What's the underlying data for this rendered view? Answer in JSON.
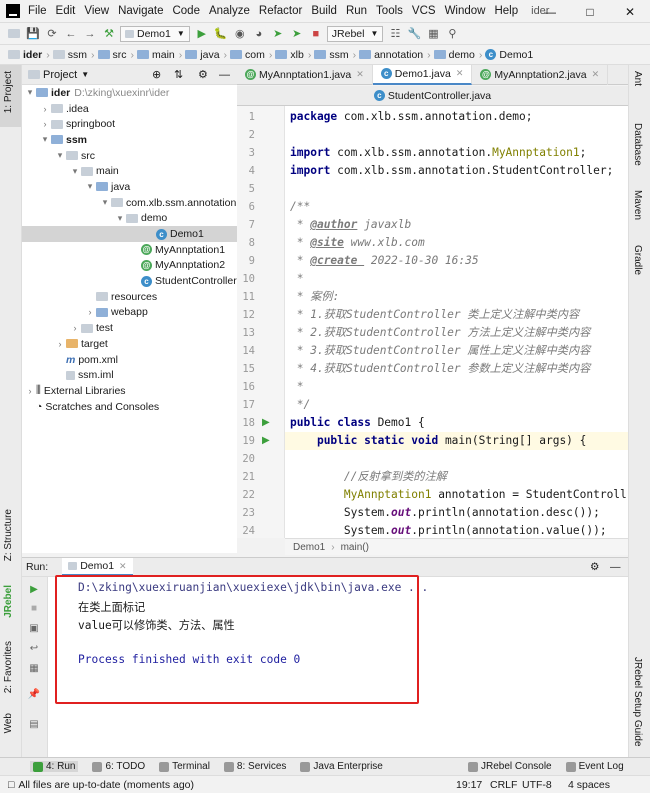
{
  "menu": [
    "File",
    "Edit",
    "View",
    "Navigate",
    "Code",
    "Analyze",
    "Refactor",
    "Build",
    "Run",
    "Tools",
    "VCS",
    "Window",
    "Help"
  ],
  "window_title": "ider",
  "toolbar": {
    "run_config": "Demo1",
    "jrebel": "JRebel"
  },
  "breadcrumb": [
    "ider",
    "ssm",
    "src",
    "main",
    "java",
    "com",
    "xlb",
    "ssm",
    "annotation",
    "demo",
    "Demo1"
  ],
  "left_tools": {
    "project": "1: Project",
    "structure": "Z: Structure",
    "jrebel": "JRebel",
    "favorites": "2: Favorites",
    "web": "Web"
  },
  "right_tools": {
    "ant": "Ant",
    "database": "Database",
    "maven": "Maven",
    "gradle": "Gradle",
    "jrebel_guide": "JRebel Setup Guide"
  },
  "project_panel": {
    "title": "Project"
  },
  "tree": [
    {
      "label": "ider",
      "extra": "D:\\zking\\xuexinr\\ider",
      "depth": 0,
      "arrow": "▾",
      "icon": "folder",
      "bold": true
    },
    {
      "label": ".idea",
      "depth": 1,
      "arrow": "›",
      "icon": "folder-plain"
    },
    {
      "label": "springboot",
      "depth": 1,
      "arrow": "›",
      "icon": "folder-plain"
    },
    {
      "label": "ssm",
      "depth": 1,
      "arrow": "▾",
      "icon": "folder",
      "bold": true
    },
    {
      "label": "src",
      "depth": 2,
      "arrow": "▾",
      "icon": "folder-plain"
    },
    {
      "label": "main",
      "depth": 3,
      "arrow": "▾",
      "icon": "folder-plain"
    },
    {
      "label": "java",
      "depth": 4,
      "arrow": "▾",
      "icon": "folder"
    },
    {
      "label": "com.xlb.ssm.annotation",
      "depth": 5,
      "arrow": "▾",
      "icon": "folder-plain"
    },
    {
      "label": "demo",
      "depth": 6,
      "arrow": "▾",
      "icon": "folder-plain"
    },
    {
      "label": "Demo1",
      "depth": 8,
      "arrow": "",
      "icon": "class",
      "selected": true
    },
    {
      "label": "MyAnnptation1",
      "depth": 7,
      "arrow": "",
      "icon": "annotation"
    },
    {
      "label": "MyAnnptation2",
      "depth": 7,
      "arrow": "",
      "icon": "annotation"
    },
    {
      "label": "StudentController",
      "depth": 7,
      "arrow": "",
      "icon": "class"
    },
    {
      "label": "resources",
      "depth": 4,
      "arrow": "",
      "icon": "folder-plain"
    },
    {
      "label": "webapp",
      "depth": 4,
      "arrow": "›",
      "icon": "folder"
    },
    {
      "label": "test",
      "depth": 3,
      "arrow": "›",
      "icon": "folder-plain"
    },
    {
      "label": "target",
      "depth": 2,
      "arrow": "›",
      "icon": "folder-orange"
    },
    {
      "label": "pom.xml",
      "depth": 2,
      "arrow": "",
      "icon": "maven"
    },
    {
      "label": "ssm.iml",
      "depth": 2,
      "arrow": "",
      "icon": "file"
    },
    {
      "label": "External Libraries",
      "depth": 0,
      "arrow": "›",
      "icon": "library"
    },
    {
      "label": "Scratches and Consoles",
      "depth": 0,
      "arrow": "",
      "icon": "scratch"
    }
  ],
  "editor_tabs": [
    {
      "label": "MyAnnptation1.java",
      "icon": "annotation"
    },
    {
      "label": "Demo1.java",
      "icon": "class",
      "active": true
    },
    {
      "label": "MyAnnptation2.java",
      "icon": "annotation"
    }
  ],
  "editor_tab_row2": "StudentController.java",
  "code_lines": [
    {
      "n": "1",
      "html": "<span class=\"kw\">package</span> com.xlb.ssm.annotation.demo;"
    },
    {
      "n": "2",
      "html": ""
    },
    {
      "n": "3",
      "html": "<span class=\"kw\">import</span> com.xlb.ssm.annotation.<span class=\"ann\">MyAnnptation1</span>;"
    },
    {
      "n": "4",
      "html": "<span class=\"kw\">import</span> com.xlb.ssm.annotation.StudentController;"
    },
    {
      "n": "5",
      "html": ""
    },
    {
      "n": "6",
      "html": "<span class=\"cm\">/**</span>"
    },
    {
      "n": "7",
      "html": "<span class=\"cm\"> * </span><span class=\"tag\">@author</span><span class=\"cm\"> javaxlb</span>"
    },
    {
      "n": "8",
      "html": "<span class=\"cm\"> * </span><span class=\"tag\">@site</span><span class=\"cm\"> www.xlb.com</span>"
    },
    {
      "n": "9",
      "html": "<span class=\"cm\"> * </span><span class=\"tag\">@create </span><span class=\"cm\"> 2022-10-30 16:35</span>"
    },
    {
      "n": "10",
      "html": "<span class=\"cm\"> *</span>"
    },
    {
      "n": "11",
      "html": "<span class=\"cm\"> * 案例:</span>"
    },
    {
      "n": "12",
      "html": "<span class=\"cm\"> * 1.获取StudentController 类上定义注解中类内容</span>"
    },
    {
      "n": "13",
      "html": "<span class=\"cm\"> * 2.获取StudentController 方法上定义注解中类内容</span>"
    },
    {
      "n": "14",
      "html": "<span class=\"cm\"> * 3.获取StudentController 属性上定义注解中类内容</span>"
    },
    {
      "n": "15",
      "html": "<span class=\"cm\"> * 4.获取StudentController 参数上定义注解中类内容</span>"
    },
    {
      "n": "16",
      "html": "<span class=\"cm\"> *</span>"
    },
    {
      "n": "17",
      "html": "<span class=\"cm\"> */</span>"
    },
    {
      "n": "18",
      "html": "<span class=\"kw\">public class</span> Demo1 {"
    },
    {
      "n": "19",
      "html": "    <span class=\"kw\">public static void</span> main(String[] args) {"
    },
    {
      "n": "20",
      "html": ""
    },
    {
      "n": "21",
      "html": "        <span class=\"cm\">//反射拿到类的注解</span>"
    },
    {
      "n": "22",
      "html": "        <span class=\"ann\">MyAnnptation1</span> annotation = StudentControll"
    },
    {
      "n": "23",
      "html": "        System.<span class=\"st\">out</span>.println(annotation.desc());"
    },
    {
      "n": "24",
      "html": "        System.<span class=\"st\">out</span>.println(annotation.value());"
    }
  ],
  "editor_breadcrumb": [
    "Demo1",
    "main()"
  ],
  "run_panel": {
    "label": "Run:",
    "tab": "Demo1"
  },
  "console": [
    {
      "text": "D:\\zking\\xuexiruanjian\\xuexiexe\\jdk\\bin\\java.exe ...",
      "color": "#3a3a80"
    },
    {
      "text": "在类上面标记",
      "color": "#1a1a1a"
    },
    {
      "text": "value可以修饰类、方法、属性",
      "color": "#1a1a1a"
    },
    {
      "text": "",
      "color": "#1a1a1a"
    },
    {
      "text": "Process finished with exit code 0",
      "color": "#2020a0"
    }
  ],
  "bottom_tools": [
    {
      "label": "4: Run"
    },
    {
      "label": "6: TODO"
    },
    {
      "label": "Terminal"
    },
    {
      "label": "8: Services"
    },
    {
      "label": "Java Enterprise"
    }
  ],
  "bottom_right_tools": [
    {
      "label": "JRebel Console"
    },
    {
      "label": "Event Log"
    }
  ],
  "status": {
    "message": "All files are up-to-date (moments ago)",
    "position": "19:17",
    "line_sep": "CRLF",
    "encoding": "UTF-8",
    "indent": "4 spaces"
  },
  "colors": {
    "accent": "#4a88c7",
    "highlight_box": "#e02020",
    "run_green": "#3c9f3c"
  }
}
